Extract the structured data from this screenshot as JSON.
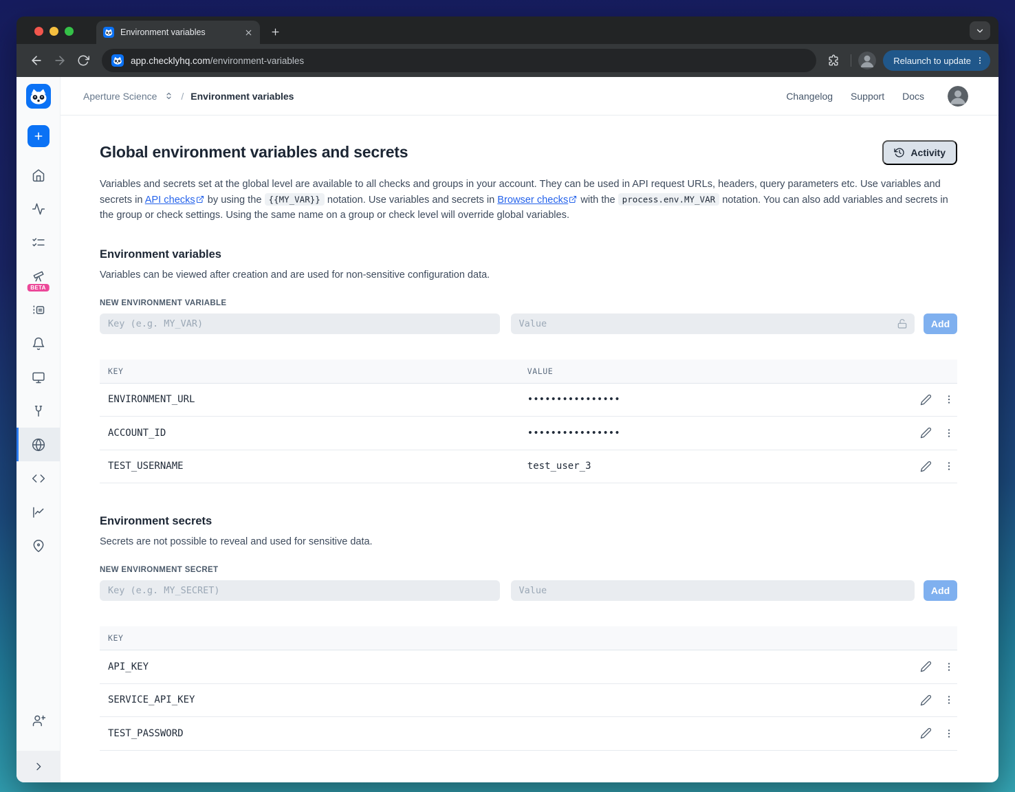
{
  "browser": {
    "tab_title": "Environment variables",
    "new_tab_icon": "plus-icon",
    "url_domain": "app.checklyhq.com",
    "url_path": "/environment-variables",
    "relaunch_label": "Relaunch to update"
  },
  "header": {
    "account": "Aperture Science",
    "separator": "/",
    "page": "Environment variables",
    "links": [
      {
        "label": "Changelog"
      },
      {
        "label": "Support"
      },
      {
        "label": "Docs"
      }
    ]
  },
  "sidebar": {
    "beta_badge": "BETA",
    "icons": [
      "checkly-logo",
      "plus-icon",
      "home-icon",
      "activity-pulse-icon",
      "checklist-icon",
      "telescope-icon",
      "log-list-icon",
      "bell-icon",
      "monitor-icon",
      "maintenance-icon",
      "globe-icon",
      "code-icon",
      "chart-icon",
      "map-pin-icon",
      "add-user-icon",
      "collapse-chevron-icon"
    ],
    "active_item": "globe"
  },
  "page": {
    "title": "Global environment variables and secrets",
    "activity_button": "Activity",
    "intro": {
      "part1": "Variables and secrets set at the global level are available to all checks and groups in your account. They can be used in API request URLs, headers, query parameters etc. Use variables and secrets in ",
      "link1": "API checks",
      "part2": " by using the ",
      "code1": "{{MY_VAR}}",
      "part3": " notation. Use variables and secrets in ",
      "link2": "Browser checks",
      "part4": " with the ",
      "code2": "process.env.MY_VAR",
      "part5": " notation. You can also add variables and secrets in the group or check settings. Using the same name on a group or check level will override global variables."
    }
  },
  "variables_section": {
    "title": "Environment variables",
    "description": "Variables can be viewed after creation and are used for non-sensitive configuration data.",
    "form_label": "NEW ENVIRONMENT VARIABLE",
    "key_placeholder": "Key (e.g. MY_VAR)",
    "value_placeholder": "Value",
    "add_label": "Add",
    "table": {
      "headers": [
        "KEY",
        "VALUE"
      ],
      "rows": [
        {
          "key": "ENVIRONMENT_URL",
          "value": "••••••••••••••••",
          "masked": true
        },
        {
          "key": "ACCOUNT_ID",
          "value": "••••••••••••••••",
          "masked": true
        },
        {
          "key": "TEST_USERNAME",
          "value": "test_user_3",
          "masked": false
        }
      ]
    }
  },
  "secrets_section": {
    "title": "Environment secrets",
    "description": "Secrets are not possible to reveal and used for sensitive data.",
    "form_label": "NEW ENVIRONMENT SECRET",
    "key_placeholder": "Key (e.g. MY_SECRET)",
    "value_placeholder": "Value",
    "add_label": "Add",
    "table": {
      "headers": [
        "KEY"
      ],
      "rows": [
        {
          "key": "API_KEY"
        },
        {
          "key": "SERVICE_API_KEY"
        },
        {
          "key": "TEST_PASSWORD"
        }
      ]
    }
  },
  "colors": {
    "brand_blue": "#0b72f5",
    "add_button_blue": "#7fb0ef",
    "link_blue": "#2563eb",
    "beta_pink": "#ec4899",
    "active_indicator_blue": "#2b7cf2",
    "relaunch_blue": "#20578a",
    "background_gradient_top": "#161c5e",
    "background_gradient_bottom": "#35a6b5"
  }
}
